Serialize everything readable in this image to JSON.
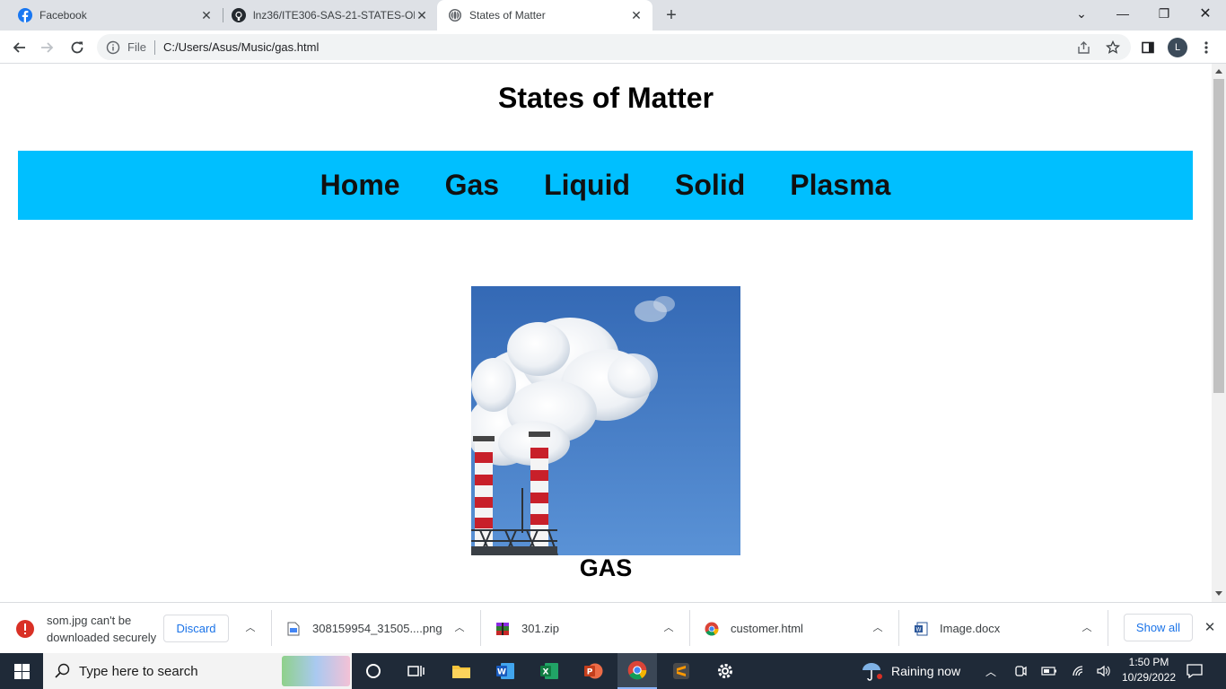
{
  "browser": {
    "tabs": [
      {
        "title": "Facebook",
        "icon": "facebook-icon",
        "active": false
      },
      {
        "title": "lnz36/ITE306-SAS-21-STATES-OF",
        "icon": "github-icon",
        "active": false
      },
      {
        "title": "States of Matter",
        "icon": "globe-icon",
        "active": true
      }
    ],
    "address": {
      "scheme_label": "File",
      "url": "C:/Users/Asus/Music/gas.html"
    },
    "profile_initial": "L"
  },
  "page": {
    "title": "States of Matter",
    "nav": [
      "Home",
      "Gas",
      "Liquid",
      "Solid",
      "Plasma"
    ],
    "caption": "GAS",
    "image": {
      "subject": "smokestacks emitting white smoke against blue sky",
      "sky_color": "#3d7ac7"
    }
  },
  "downloads": {
    "warning": {
      "line1": "som.jpg can't be",
      "line2": "downloaded securely",
      "discard_label": "Discard"
    },
    "items": [
      {
        "name": "308159954_31505....png",
        "icon": "image-file-icon"
      },
      {
        "name": "301.zip",
        "icon": "winrar-icon"
      },
      {
        "name": "customer.html",
        "icon": "chrome-icon"
      },
      {
        "name": "Image.docx",
        "icon": "word-icon"
      }
    ],
    "show_all_label": "Show all"
  },
  "taskbar": {
    "search_placeholder": "Type here to search",
    "weather": "Raining now",
    "time": "1:50 PM",
    "date": "10/29/2022"
  },
  "colors": {
    "nav_bg": "#00bfff",
    "tabstrip_bg": "#dee1e6",
    "taskbar_bg": "#1f2a38",
    "accent": "#1a73e8"
  }
}
